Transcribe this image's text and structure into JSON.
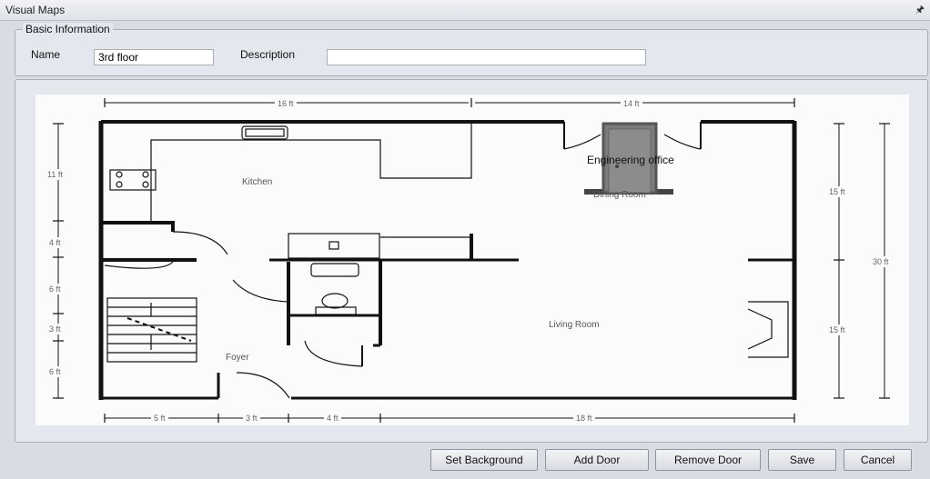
{
  "window": {
    "title": "Visual Maps",
    "pin_icon": "pin-icon"
  },
  "basic_info": {
    "legend": "Basic Information",
    "name_label": "Name",
    "name_value": "3rd floor",
    "description_label": "Description",
    "description_value": ""
  },
  "floorplan": {
    "room_labels": [
      "Kitchen",
      "Dining Room",
      "Living Room",
      "Foyer"
    ],
    "door": {
      "label": "Engineering office",
      "icon": "door-icon"
    },
    "top_dims": [
      "16 ft",
      "14 ft"
    ],
    "bottom_dims": [
      "5 ft",
      "3 ft",
      "4 ft",
      "18 ft"
    ],
    "left_dims": [
      "11 ft",
      "4 ft",
      "6 ft",
      "3 ft",
      "6 ft"
    ],
    "right_dims": [
      "15 ft",
      "15 ft",
      "30 ft"
    ]
  },
  "buttons": {
    "set_background": "Set Background",
    "add_door": "Add Door",
    "remove_door": "Remove Door",
    "save": "Save",
    "cancel": "Cancel"
  }
}
